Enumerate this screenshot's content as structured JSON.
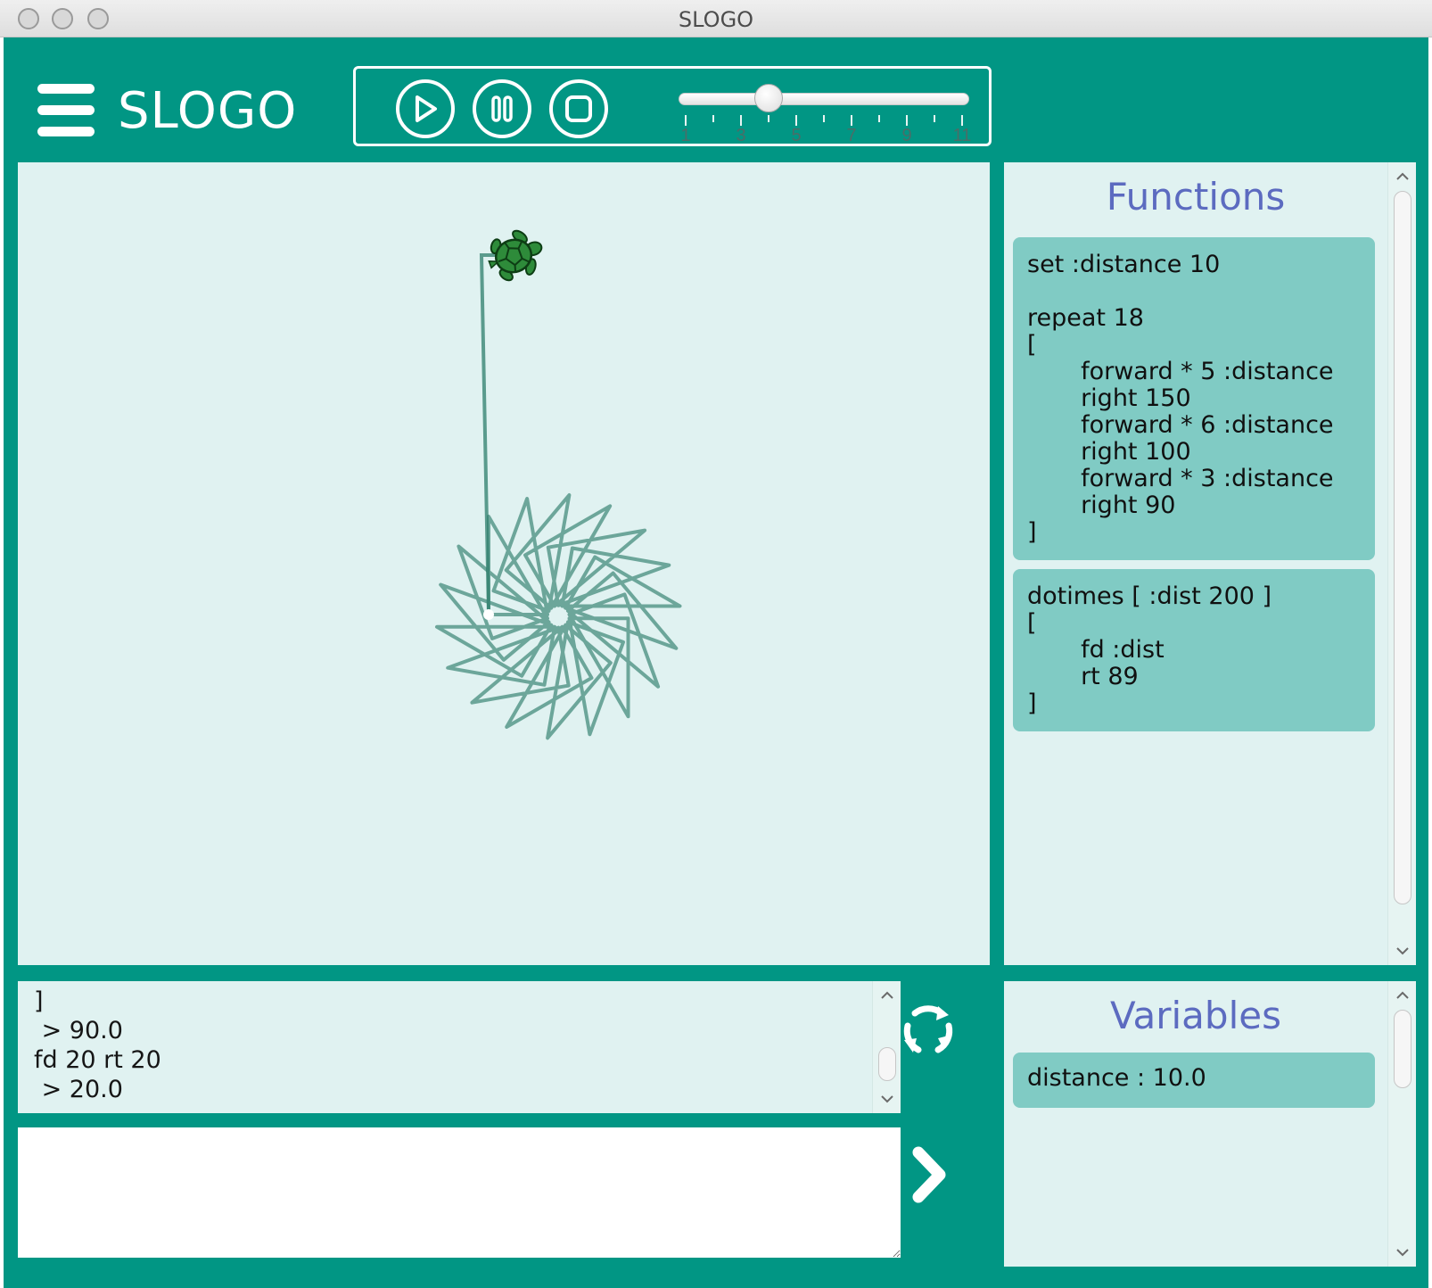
{
  "window": {
    "title": "SLOGO"
  },
  "header": {
    "app_title": "SLOGO",
    "speed_slider": {
      "value": 4,
      "min": 1,
      "max": 11,
      "tick_labels": [
        "1",
        "3",
        "5",
        "7",
        "9",
        "11"
      ]
    }
  },
  "colors": {
    "app_background": "#019684",
    "panel_background": "#e0f2f1",
    "card_background": "#80cbc4",
    "panel_title": "#5c6bc0",
    "pen": "#2e7d6b",
    "turtle": "#2e8b3a"
  },
  "functions_panel": {
    "title": "Functions",
    "cards": [
      "set :distance 10\n\nrepeat 18\n[\n       forward * 5 :distance\n       right 150\n       forward * 6 :distance\n       right 100\n       forward * 3 :distance\n       right 90\n]",
      "dotimes [ :dist 200 ]\n[\n       fd :dist\n       rt 89\n]"
    ]
  },
  "variables_panel": {
    "title": "Variables",
    "cards": [
      "distance : 10.0"
    ]
  },
  "console": {
    "lines": "]\n > 90.0\nfd 20 rt 20\n > 20.0"
  },
  "command_input": {
    "value": "",
    "placeholder": ""
  },
  "icons": {
    "menu": "menu-icon",
    "play": "play-icon",
    "pause": "pause-icon",
    "stop": "stop-icon",
    "refresh": "refresh-icon",
    "run": "chevron-right-icon",
    "turtle": "turtle-icon"
  }
}
